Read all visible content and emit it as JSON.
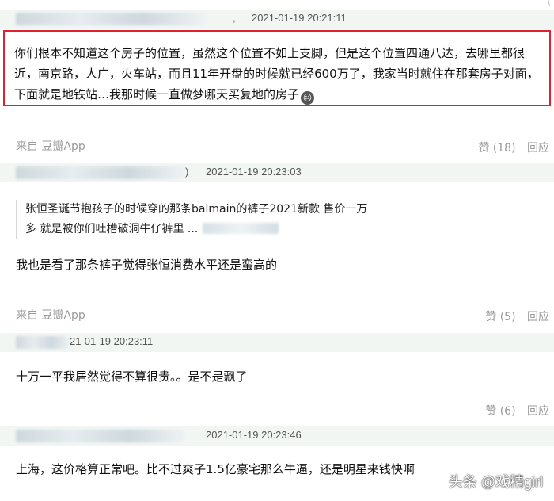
{
  "comments": [
    {
      "timestamp": "2021-01-19 20:21:11",
      "text": "你们根本不知道这个房子的位置，虽然这个位置不如上支脚，但是这个位置四通八达，去哪里都很近，南京路，人广，火车站，而且11年开盘的时候就已经600万了，我家当时就住在那套房子对面，下面就是地铁站…我那时候一直做梦哪天买复地的房子",
      "source": "来自 豆瓣App",
      "likes": "赞 (18)",
      "reply": "回应"
    },
    {
      "timestamp": "2021-01-19 20:23:03",
      "quote_line1": "张恒圣诞节抱孩子的时候穿的那条balmain的裤子2021新款 售价一万",
      "quote_line2": "多 就是被你们吐槽破洞牛仔裤里 ...",
      "text": "我也是看了那条裤子觉得张恒消费水平还是蛮高的",
      "source": "来自 豆瓣App",
      "likes": "赞 (5)",
      "reply": "回应"
    },
    {
      "timestamp": "21-01-19 20:23:11",
      "text": "十万一平我居然觉得不算很贵。。是不是飘了",
      "likes": "赞 (6)",
      "reply": "回应"
    },
    {
      "timestamp": "2021-01-19 20:23:46",
      "text": "上海，这价格算正常吧。比不过爽子1.5亿豪宅那么牛逼，还是明星来钱快啊"
    }
  ],
  "top_partial": "(",
  "first_sep": ",",
  "second_sep": ")",
  "emoji_icon": "sad-face-icon",
  "watermark": "头条 @戏精girl",
  "colors": {
    "highlight_border": "#e0202c",
    "header_bg": "#f1f6f3",
    "meta_text": "#9a9a9a"
  }
}
